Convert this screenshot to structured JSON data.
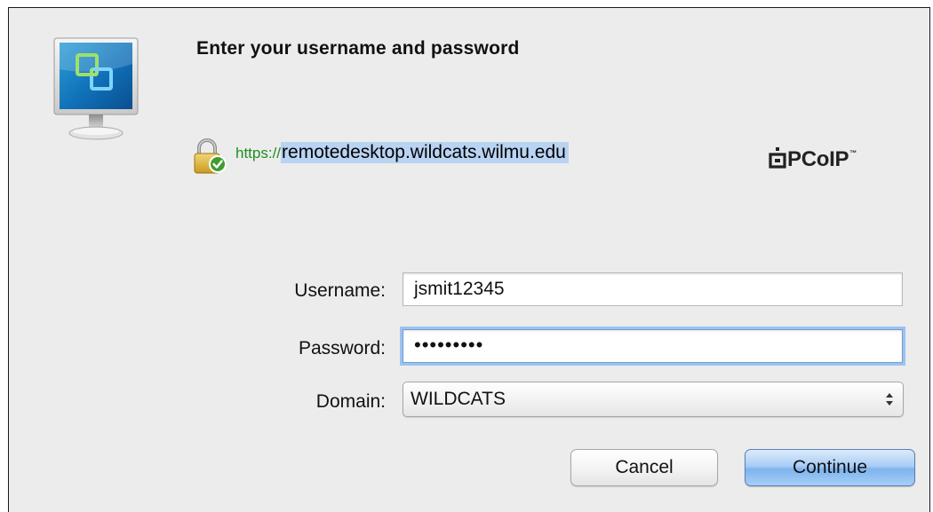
{
  "dialog": {
    "title": "Enter your username and password",
    "icon": "vmware-view-client-icon"
  },
  "connection": {
    "lock_icon": "secure-lock-icon",
    "scheme": "https://",
    "host": "remotedesktop.wildcats.wilmu.edu",
    "protocol_logo": "PCoIP",
    "protocol_tm": "™"
  },
  "form": {
    "username_label": "Username:",
    "username_value": "jsmit12345",
    "password_label": "Password:",
    "password_value": "•••••••••",
    "domain_label": "Domain:",
    "domain_value": "WILDCATS"
  },
  "buttons": {
    "cancel_label": "Cancel",
    "continue_label": "Continue"
  },
  "colors": {
    "background": "#ececec",
    "url_scheme": "#1d8f1d",
    "url_highlight": "#b9d3f3",
    "focus_ring": "#9cc2ef",
    "default_button": "#7fb3ee"
  }
}
